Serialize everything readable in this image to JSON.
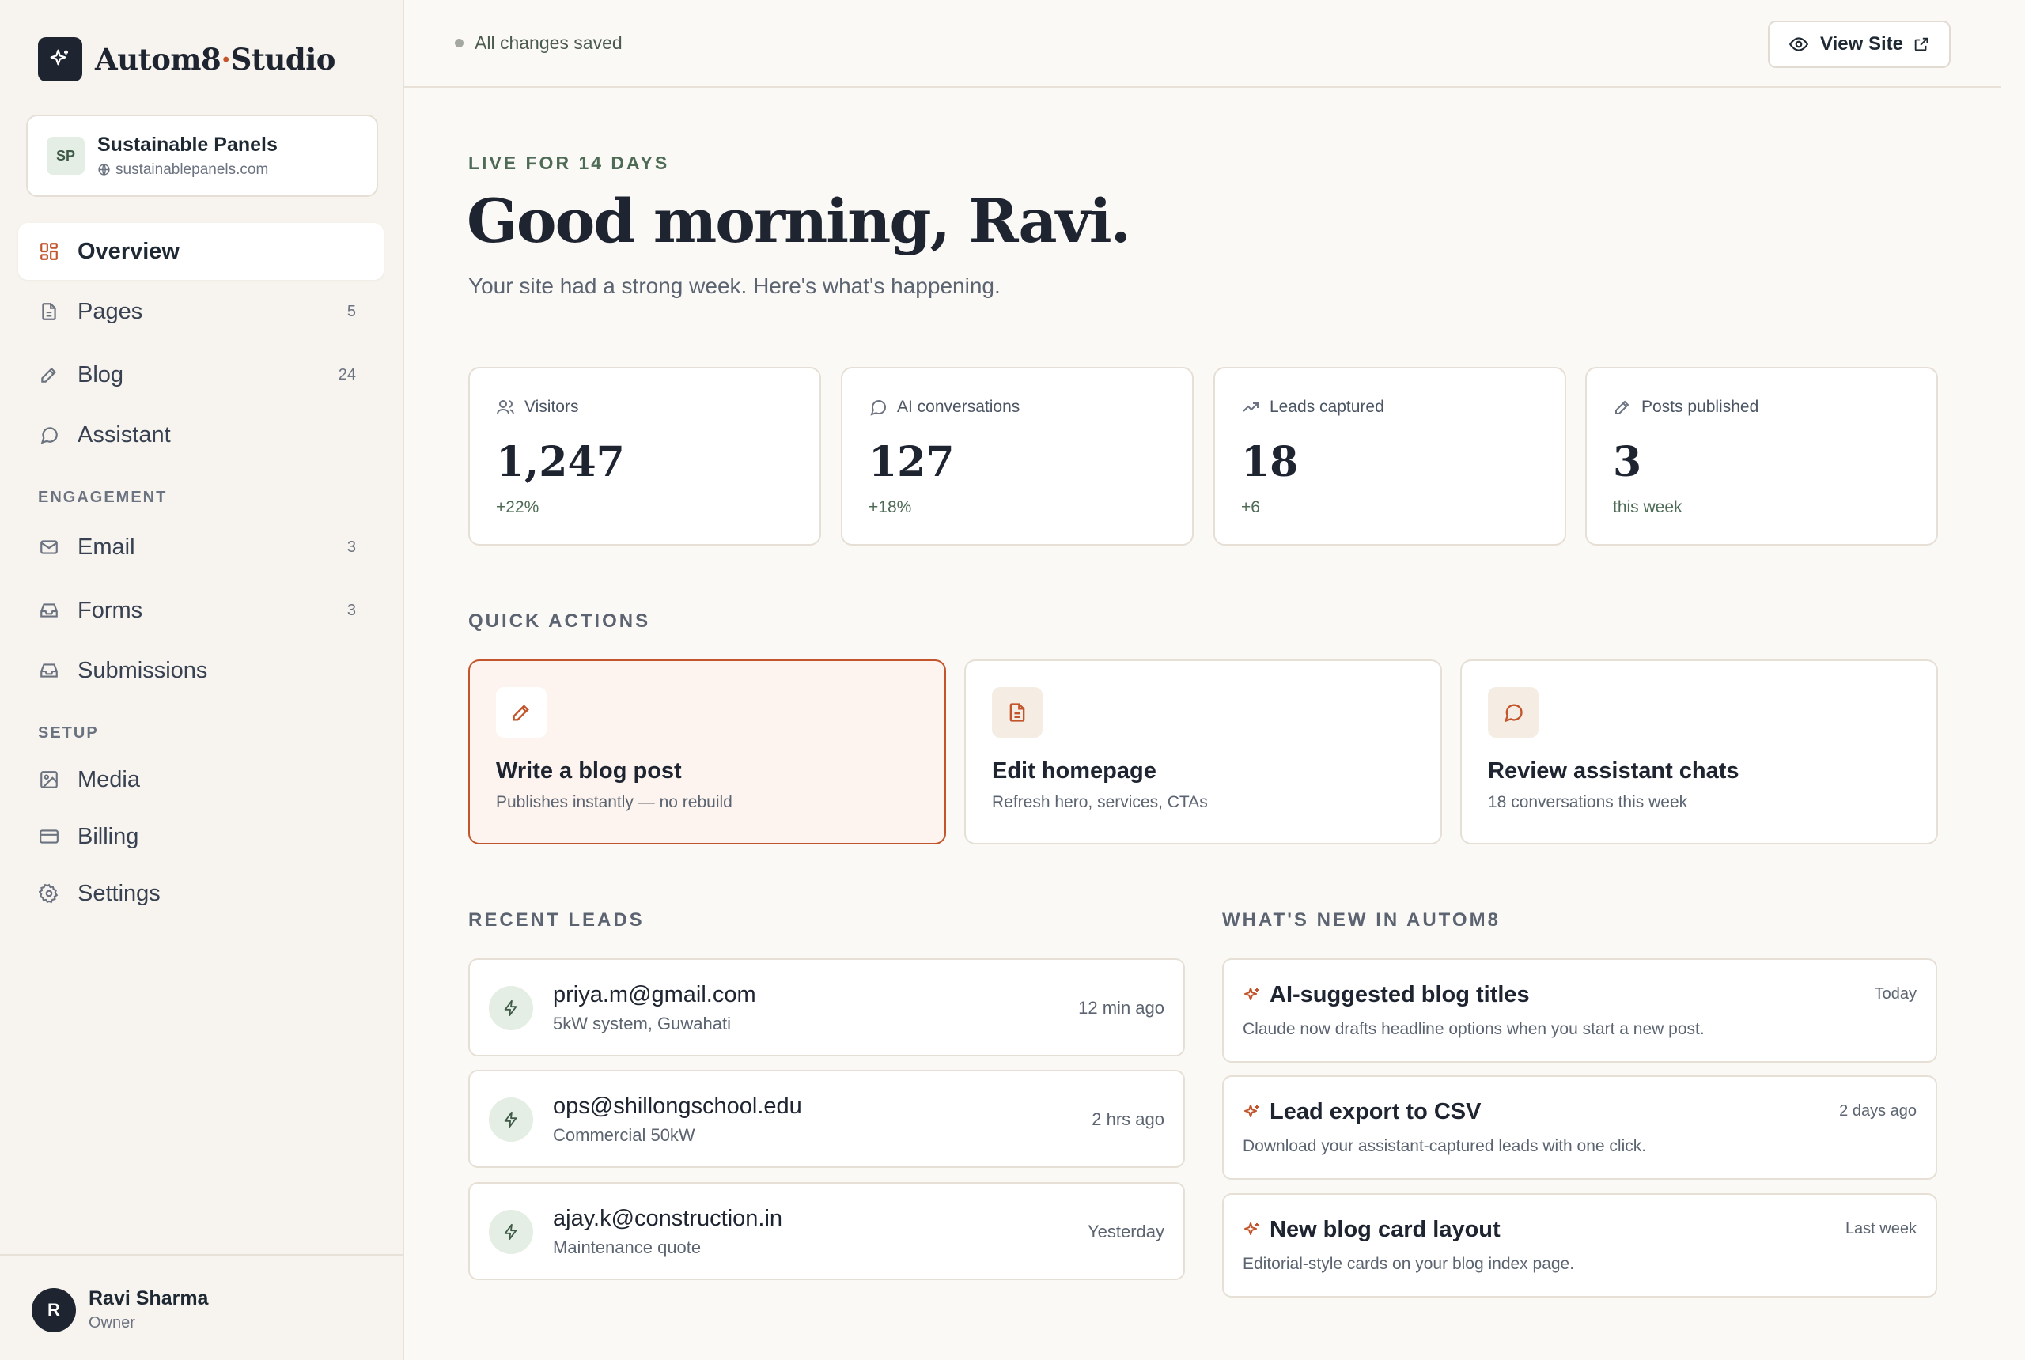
{
  "brand": {
    "name_part1": "Autom8",
    "name_dot": "·",
    "name_part2": "Studio"
  },
  "site": {
    "initials": "SP",
    "name": "Sustainable Panels",
    "url": "sustainablepanels.com"
  },
  "nav": {
    "overview": {
      "label": "Overview",
      "icon": "grid-icon",
      "active": true
    },
    "pages": {
      "label": "Pages",
      "count": "5",
      "icon": "document-icon"
    },
    "blog": {
      "label": "Blog",
      "count": "24",
      "icon": "pencil-icon"
    },
    "assistant": {
      "label": "Assistant",
      "icon": "chat-bubble-icon"
    },
    "engagement_heading": "ENGAGEMENT",
    "email": {
      "label": "Email",
      "count": "3",
      "icon": "mail-icon"
    },
    "forms": {
      "label": "Forms",
      "count": "3",
      "icon": "inbox-icon"
    },
    "submissions": {
      "label": "Submissions",
      "icon": "inbox-icon"
    },
    "setup_heading": "SETUP",
    "media": {
      "label": "Media",
      "icon": "image-icon"
    },
    "billing": {
      "label": "Billing",
      "icon": "credit-card-icon"
    },
    "settings": {
      "label": "Settings",
      "icon": "gear-icon"
    }
  },
  "user": {
    "initial": "R",
    "name": "Ravi Sharma",
    "role": "Owner"
  },
  "topbar": {
    "save_status": "All changes saved",
    "view_site_label": "View Site"
  },
  "hero": {
    "eyebrow": "LIVE FOR 14 DAYS",
    "greeting": "Good morning, Ravi.",
    "subhead": "Your site had a strong week. Here's what's happening."
  },
  "stats": [
    {
      "label": "Visitors",
      "value": "1,247",
      "delta": "+22%",
      "icon": "users-icon"
    },
    {
      "label": "AI conversations",
      "value": "127",
      "delta": "+18%",
      "icon": "chat-bubble-icon"
    },
    {
      "label": "Leads captured",
      "value": "18",
      "delta": "+6",
      "icon": "trending-up-icon"
    },
    {
      "label": "Posts published",
      "value": "3",
      "delta": "this week",
      "icon": "pencil-icon"
    }
  ],
  "quick_actions": {
    "heading": "QUICK ACTIONS",
    "items": [
      {
        "title": "Write a blog post",
        "subtitle": "Publishes instantly — no rebuild",
        "icon": "pencil-icon"
      },
      {
        "title": "Edit homepage",
        "subtitle": "Refresh hero, services, CTAs",
        "icon": "document-icon"
      },
      {
        "title": "Review assistant chats",
        "subtitle": "18 conversations this week",
        "icon": "chat-bubble-icon"
      }
    ]
  },
  "recent_leads": {
    "heading": "RECENT LEADS",
    "items": [
      {
        "email": "priya.m@gmail.com",
        "detail": "5kW system, Guwahati",
        "time": "12 min ago"
      },
      {
        "email": "ops@shillongschool.edu",
        "detail": "Commercial 50kW",
        "time": "2 hrs ago"
      },
      {
        "email": "ajay.k@construction.in",
        "detail": "Maintenance quote",
        "time": "Yesterday"
      }
    ]
  },
  "whats_new": {
    "heading": "WHAT'S NEW IN AUTOM8",
    "items": [
      {
        "title": "AI-suggested blog titles",
        "description": "Claude now drafts headline options when you start a new post.",
        "time": "Today"
      },
      {
        "title": "Lead export to CSV",
        "description": "Download your assistant-captured leads with one click.",
        "time": "2 days ago"
      },
      {
        "title": "New blog card layout",
        "description": "Editorial-style cards on your blog index page.",
        "time": "Last week"
      }
    ]
  },
  "colors": {
    "accent": "#C2552B",
    "dark": "#1E2430",
    "green": "#4E6B55",
    "background": "#FBF9F6",
    "sidebar": "#F7F3EE"
  }
}
